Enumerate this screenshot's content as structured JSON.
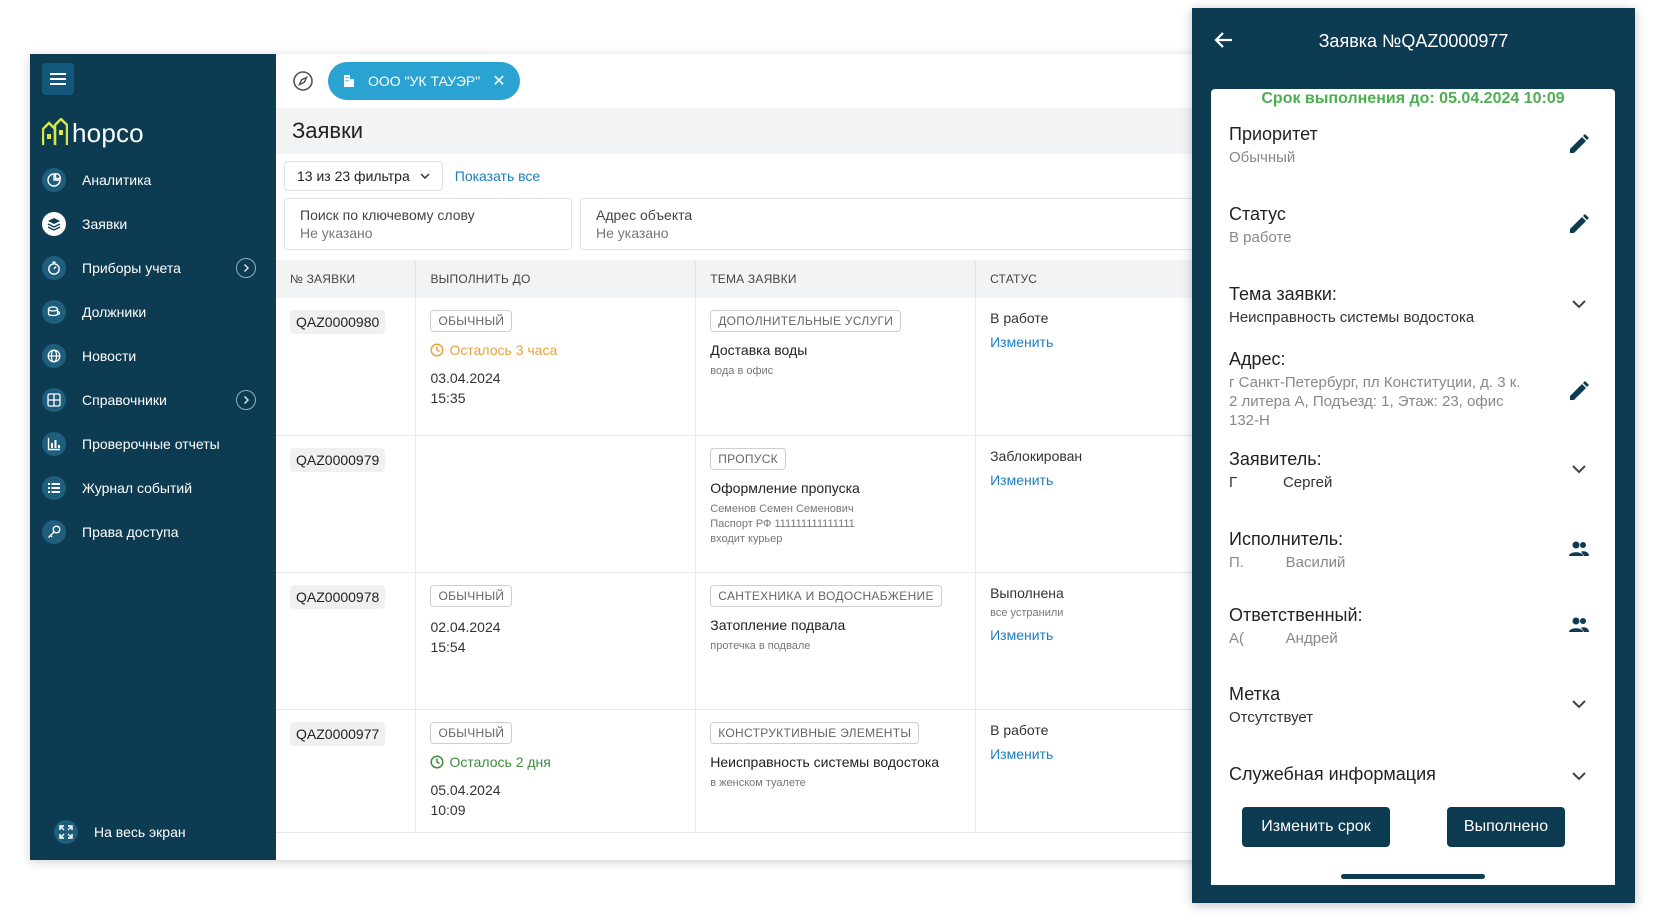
{
  "app": {
    "logo_text": "hopco"
  },
  "sidebar": {
    "items": [
      {
        "label": "Аналитика",
        "icon": "pie-chart-icon",
        "has_chevron": false,
        "active": false
      },
      {
        "label": "Заявки",
        "icon": "layers-icon",
        "has_chevron": false,
        "active": true
      },
      {
        "label": "Приборы учета",
        "icon": "meter-icon",
        "has_chevron": true,
        "active": false
      },
      {
        "label": "Должники",
        "icon": "coins-icon",
        "has_chevron": false,
        "active": false
      },
      {
        "label": "Новости",
        "icon": "globe-icon",
        "has_chevron": false,
        "active": false
      },
      {
        "label": "Справочники",
        "icon": "grid-icon",
        "has_chevron": true,
        "active": false
      },
      {
        "label": "Проверочные отчеты",
        "icon": "bar-chart-icon",
        "has_chevron": false,
        "active": false
      },
      {
        "label": "Журнал событий",
        "icon": "list-icon",
        "has_chevron": false,
        "active": false
      },
      {
        "label": "Права доступа",
        "icon": "key-icon",
        "has_chevron": false,
        "active": false
      }
    ],
    "fullscreen_label": "На весь экран"
  },
  "topbar": {
    "org_chip": "ООО \"УК ТАУЭР\""
  },
  "page": {
    "title": "Заявки",
    "filter_dropdown": "13 из 23 фильтра",
    "show_all": "Показать все",
    "search_keyword": {
      "label": "Поиск по ключевому слову",
      "value": "Не указано"
    },
    "search_address": {
      "label": "Адрес объекта",
      "value": "Не указано"
    }
  },
  "table": {
    "columns": [
      "№ ЗАЯВКИ",
      "ВЫПОЛНИТЬ ДО",
      "ТЕМА ЗАЯВКИ",
      "СТАТУС"
    ],
    "change_label": "Изменить",
    "rows": [
      {
        "id": "QAZ0000980",
        "priority": "ОБЫЧНЫЙ",
        "remaining": "Осталось 3 часа",
        "remaining_color": "#e8a33a",
        "date": "03.04.2024",
        "time": "15:35",
        "topic": "ДОПОЛНИТЕЛЬНЫЕ УСЛУГИ",
        "title": "Доставка воды",
        "desc": [
          "вода в офис"
        ],
        "status": "В работе",
        "status_note": ""
      },
      {
        "id": "QAZ0000979",
        "priority": "",
        "remaining": "",
        "remaining_color": "",
        "date": "",
        "time": "",
        "topic": "ПРОПУСК",
        "title": "Оформление пропуска",
        "desc": [
          "Семенов Семен Семенович",
          "Паспорт РФ 111111111111111",
          "входит курьер"
        ],
        "status": "Заблокирован",
        "status_note": ""
      },
      {
        "id": "QAZ0000978",
        "priority": "ОБЫЧНЫЙ",
        "remaining": "",
        "remaining_color": "",
        "date": "02.04.2024",
        "time": "15:54",
        "topic": "САНТЕХНИКА И ВОДОСНАБЖЕНИЕ",
        "title": "Затопление подвала",
        "desc": [
          "протечка в подвале"
        ],
        "status": "Выполнена",
        "status_note": "все устранили"
      },
      {
        "id": "QAZ0000977",
        "priority": "ОБЫЧНЫЙ",
        "remaining": "Осталось 2 дня",
        "remaining_color": "#3d8b3d",
        "date": "05.04.2024",
        "time": "10:09",
        "topic": "КОНСТРУКТИВНЫЕ ЭЛЕМЕНТЫ",
        "title": "Неисправность системы водостока",
        "desc": [
          "в женском туалете"
        ],
        "status": "В работе",
        "status_note": ""
      }
    ]
  },
  "mobile": {
    "title": "Заявка №QAZ0000977",
    "deadline": "Срок выполнения до: 05.04.2024 10:09",
    "priority": {
      "label": "Приоритет",
      "value": "Обычный"
    },
    "status": {
      "label": "Статус",
      "value": "В работе"
    },
    "topic": {
      "label": "Тема заявки:",
      "value": "Неисправность системы водостока"
    },
    "address": {
      "label": "Адрес:",
      "value": "г Санкт-Петербург, пл Конституции, д. 3 к. 2 литера А, Подъезд: 1, Этаж: 23, офис 132-Н"
    },
    "applicant": {
      "label": "Заявитель:",
      "value": "Г           Сергей"
    },
    "executor": {
      "label": "Исполнитель:",
      "value": "П.          Василий"
    },
    "responsible": {
      "label": "Ответственный:",
      "value": "А(          Андрей"
    },
    "tag": {
      "label": "Метка",
      "value": "Отсутствует"
    },
    "service": {
      "label": "Служебная информация"
    },
    "btn_change_deadline": "Изменить срок",
    "btn_done": "Выполнено"
  },
  "colors": {
    "sidebar_bg": "#0d3b52",
    "accent": "#2aa3d3",
    "link": "#1a7fbf",
    "deadline_green": "#4caf50",
    "warn_orange": "#e8a33a",
    "ok_green": "#3d8b3d"
  }
}
